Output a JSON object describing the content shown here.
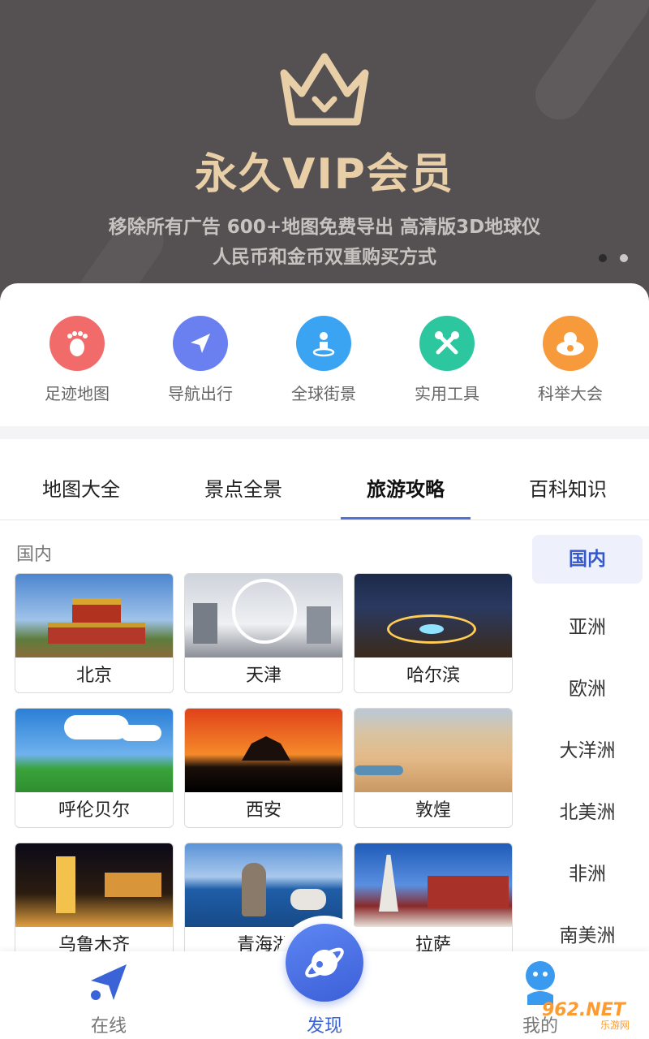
{
  "banner": {
    "title": "永久VIP会员",
    "line1": "移除所有广告  600+地图免费导出 高清版3D地球仪",
    "line2": "人民币和金币双重购买方式",
    "icon": "crown-icon"
  },
  "quick_items": [
    {
      "label": "足迹地图",
      "icon": "footprint-icon",
      "color": "#f26b6b"
    },
    {
      "label": "导航出行",
      "icon": "navigation-arrow-icon",
      "color": "#6a7ff0"
    },
    {
      "label": "全球街景",
      "icon": "location-person-icon",
      "color": "#3aa3f2"
    },
    {
      "label": "实用工具",
      "icon": "tools-icon",
      "color": "#2cc79e"
    },
    {
      "label": "科举大会",
      "icon": "cloud-exam-icon",
      "color": "#f79a3c"
    }
  ],
  "tabs": [
    {
      "label": "地图大全"
    },
    {
      "label": "景点全景"
    },
    {
      "label": "旅游攻略"
    },
    {
      "label": "百科知识"
    }
  ],
  "active_tab": "旅游攻略",
  "section_title": "国内",
  "cities": [
    {
      "name": "北京"
    },
    {
      "name": "天津"
    },
    {
      "name": "哈尔滨"
    },
    {
      "name": "呼伦贝尔"
    },
    {
      "name": "西安"
    },
    {
      "name": "敦煌"
    },
    {
      "name": "乌鲁木齐"
    },
    {
      "name": "青海湖"
    },
    {
      "name": "拉萨"
    }
  ],
  "side_menu": [
    {
      "label": "国内"
    },
    {
      "label": "亚洲"
    },
    {
      "label": "欧洲"
    },
    {
      "label": "大洋洲"
    },
    {
      "label": "北美洲"
    },
    {
      "label": "非洲"
    },
    {
      "label": "南美洲"
    }
  ],
  "bottom_nav": {
    "online": "在线",
    "discover": "发现",
    "mine": "我的"
  },
  "watermark": {
    "logo": "962.NET",
    "sub": "乐游网"
  },
  "colors": {
    "accent": "#3b63d8",
    "banner_bg": "#555152",
    "gold": "#e9cfa8"
  }
}
